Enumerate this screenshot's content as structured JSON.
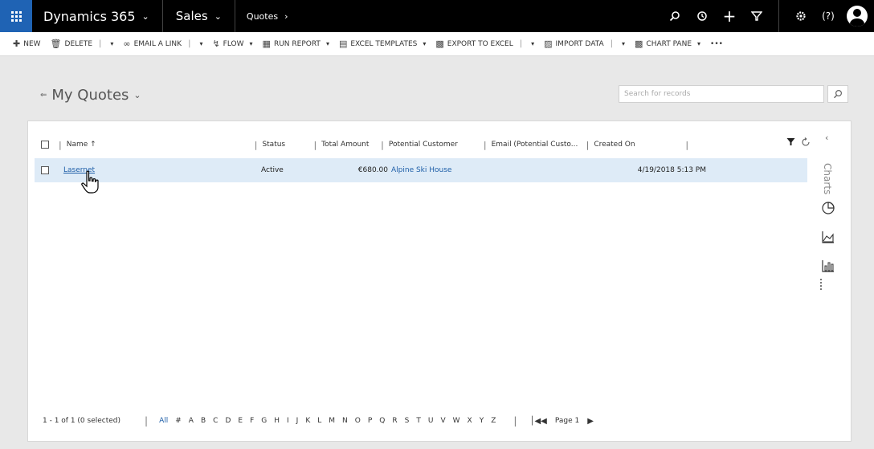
{
  "topnav": {
    "brand": "Dynamics 365",
    "app": "Sales",
    "area": "Quotes",
    "icons": [
      "search-icon",
      "history-icon",
      "plus-icon",
      "filter-icon",
      "gear-icon",
      "help-icon",
      "avatar-icon"
    ]
  },
  "commands": {
    "new": "NEW",
    "delete": "DELETE",
    "email": "EMAIL A LINK",
    "flow": "FLOW",
    "run_report": "RUN REPORT",
    "excel_templates": "EXCEL TEMPLATES",
    "export": "EXPORT TO EXCEL",
    "import": "IMPORT DATA",
    "chart_pane": "CHART PANE",
    "more": "•••"
  },
  "view": {
    "title": "My Quotes",
    "search_placeholder": "Search for records"
  },
  "grid": {
    "columns": {
      "name": "Name ↑",
      "status": "Status",
      "total": "Total Amount",
      "customer": "Potential Customer",
      "email": "Email (Potential Custo...",
      "created": "Created On"
    },
    "rows": [
      {
        "name": "Lasernet",
        "status": "Active",
        "total": "€680.00",
        "customer": "Alpine Ski House",
        "email": "",
        "created": "4/19/2018 5:13 PM"
      }
    ]
  },
  "rail": {
    "label": "Charts"
  },
  "footer": {
    "count": "1 - 1 of 1 (0 selected)",
    "alpha": [
      "All",
      "#",
      "A",
      "B",
      "C",
      "D",
      "E",
      "F",
      "G",
      "H",
      "I",
      "J",
      "K",
      "L",
      "M",
      "N",
      "O",
      "P",
      "Q",
      "R",
      "S",
      "T",
      "U",
      "V",
      "W",
      "X",
      "Y",
      "Z"
    ],
    "page": "Page 1"
  },
  "colors": {
    "nav_bg": "#000000",
    "waffle": "#1f63b4",
    "link": "#1f5fa8",
    "selected_row": "#deebf7"
  }
}
